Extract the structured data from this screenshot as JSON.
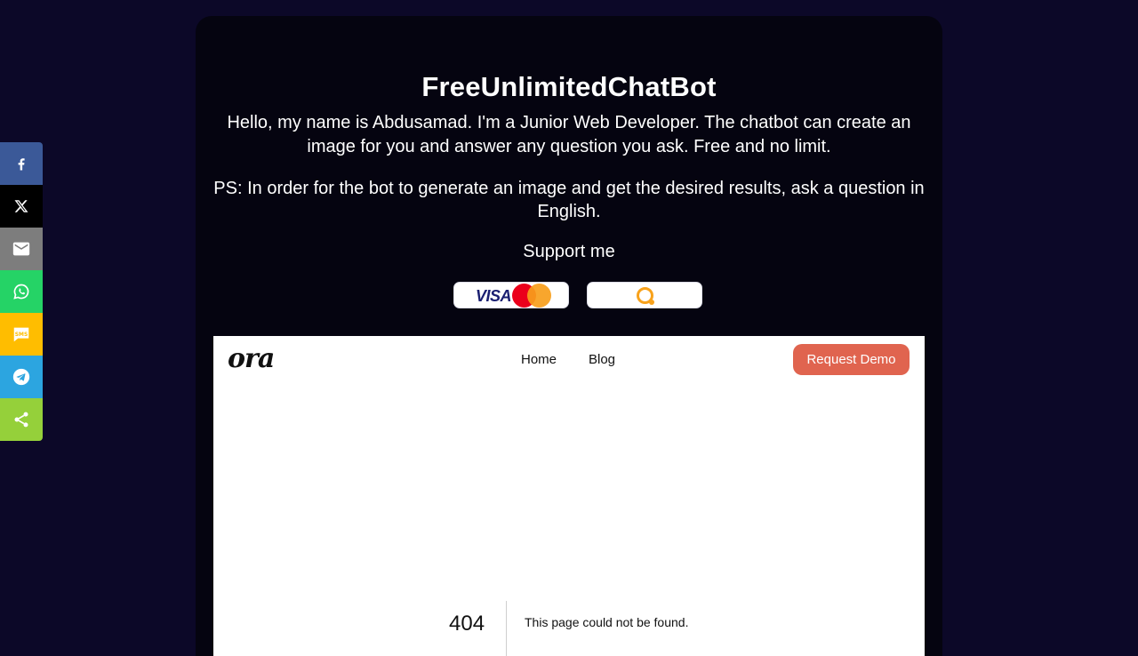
{
  "header": {
    "title": "FreeUnlimitedChatBot",
    "intro": "Hello, my name is Abdusamad. I'm a Junior Web Developer. The chatbot can create an image for you and answer any question you ask. Free and no limit.",
    "ps": "PS: In order for the bot to generate an image and get the desired results, ask a question in English.",
    "support_label": "Support me"
  },
  "payment_buttons": [
    {
      "name": "visa-mastercard",
      "visa_text": "VISA",
      "icons": [
        "visa-logo",
        "mastercard-icon"
      ]
    },
    {
      "name": "qiwi",
      "icons": [
        "qiwi-icon"
      ]
    }
  ],
  "embed": {
    "logo_text": "ora",
    "nav": [
      {
        "label": "Home"
      },
      {
        "label": "Blog"
      }
    ],
    "cta_label": "Request Demo",
    "error_code": "404",
    "error_message": "This page could not be found."
  },
  "share_bar": [
    {
      "name": "facebook",
      "icon": "facebook-icon",
      "color": "#3b5998"
    },
    {
      "name": "x",
      "icon": "x-icon",
      "color": "#000000"
    },
    {
      "name": "email",
      "icon": "email-icon",
      "color": "#7d7d7d"
    },
    {
      "name": "whatsapp",
      "icon": "whatsapp-icon",
      "color": "#25d366"
    },
    {
      "name": "sms",
      "icon": "sms-icon",
      "color": "#ffbd00"
    },
    {
      "name": "telegram",
      "icon": "telegram-icon",
      "color": "#2ca5e0"
    },
    {
      "name": "share",
      "icon": "share-icon",
      "color": "#95d03a"
    }
  ],
  "colors": {
    "page_background": "#0c0828",
    "card_background": "#050410",
    "cta": "#e0644f",
    "mastercard_red": "#eb001b",
    "mastercard_yellow": "#f79e1b",
    "qiwi_orange": "#f8a21b",
    "visa_blue": "#1a1f71"
  }
}
